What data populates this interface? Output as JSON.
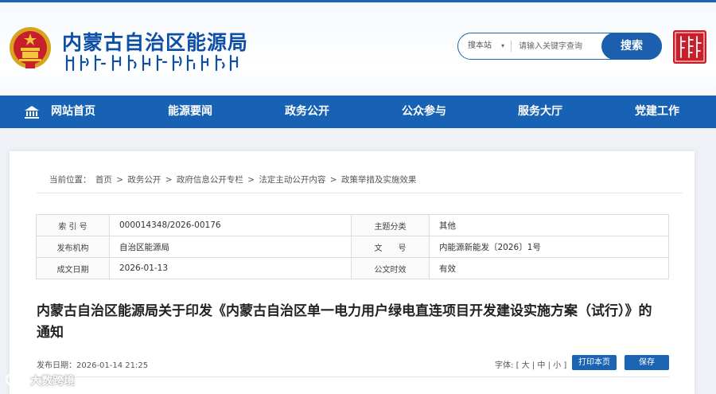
{
  "header": {
    "site_title": "内蒙古自治区能源局",
    "search": {
      "scope_label": "搜本站",
      "placeholder": "请输入关键字查询",
      "button_label": "搜索"
    },
    "seal_text": "内蒙古"
  },
  "nav": {
    "items": [
      {
        "label": "网站首页"
      },
      {
        "label": "能源要闻"
      },
      {
        "label": "政务公开"
      },
      {
        "label": "公众参与"
      },
      {
        "label": "服务大厅"
      },
      {
        "label": "党建工作"
      }
    ]
  },
  "breadcrumb": {
    "prefix": "当前位置：",
    "items": [
      "首页",
      "政务公开",
      "政府信息公开专栏",
      "法定主动公开内容",
      "政策举措及实施效果"
    ],
    "separator": ">"
  },
  "meta": {
    "rows": [
      {
        "l1": "索 引 号",
        "v1": "000014348/2026-00176",
        "l2": "主题分类",
        "v2": "其他"
      },
      {
        "l1": "发布机构",
        "v1": "自治区能源局",
        "l2": "文　　号",
        "v2": "内能源新能发〔2026〕1号"
      },
      {
        "l1": "成文日期",
        "v1": "2026-01-13",
        "l2": "公文时效",
        "v2": "有效"
      }
    ]
  },
  "article": {
    "title": "内蒙古自治区能源局关于印发《内蒙古自治区单一电力用户绿电直连项目开发建设实施方案（试行）》的通知",
    "publish_date": "发布日期：2026-01-14 21:25",
    "font_size_label": "字体:",
    "font_sizes": [
      "大",
      "中",
      "小"
    ],
    "print_label": "打印本页",
    "save_label": "保存"
  },
  "watermark": {
    "text": "大数跨境"
  },
  "colors": {
    "primary": "#1762b5",
    "title_blue": "#0d4fa5",
    "seal_red": "#c7202a"
  }
}
